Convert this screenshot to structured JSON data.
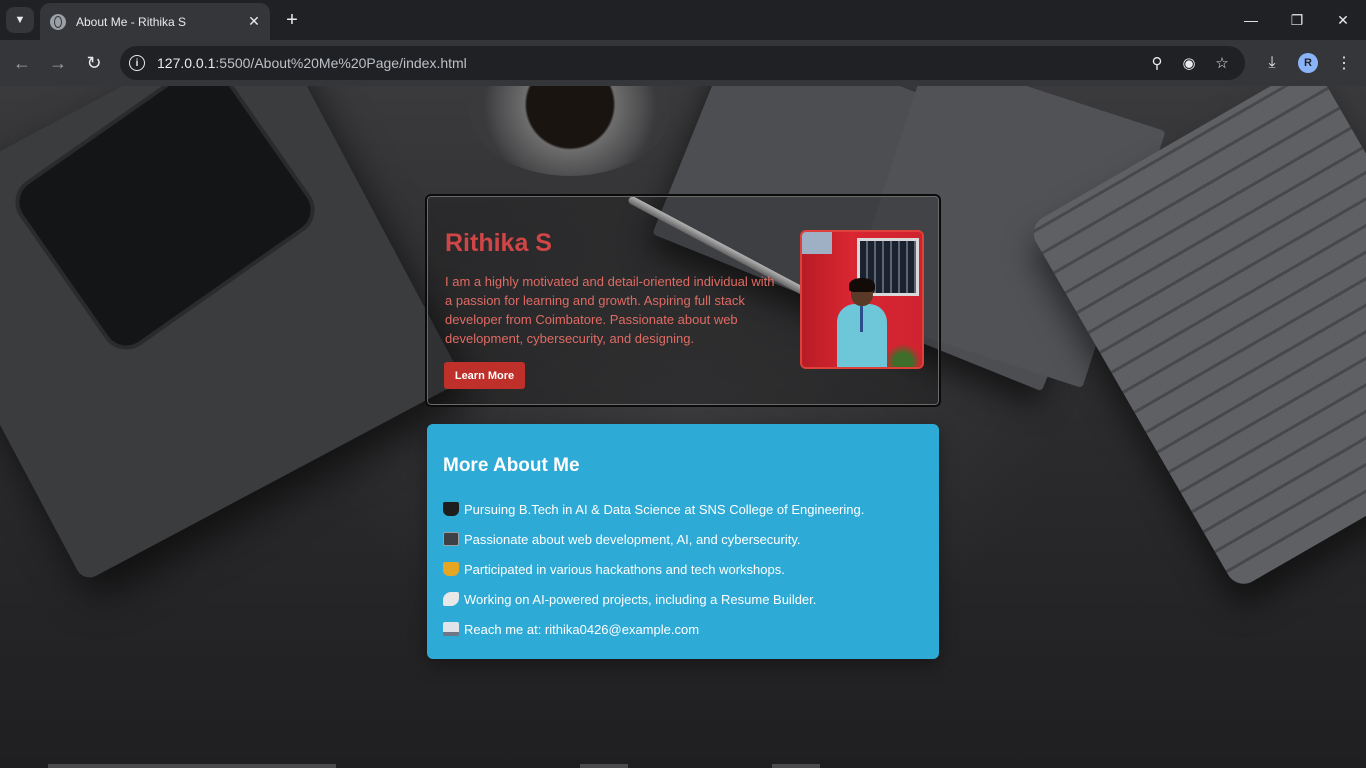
{
  "browser": {
    "tab_title": "About Me - Rithika S",
    "url_host": "127.0.0.1",
    "url_path": ":5500/About%20Me%20Page/index.html",
    "profile_initial": "R",
    "icons": {
      "tab_search": "chevron-down-icon",
      "favicon": "globe-icon",
      "tab_close": "close-icon",
      "new_tab": "plus-icon",
      "minimize": "minimize-icon",
      "restore": "restore-icon",
      "window_close": "close-icon",
      "back": "arrow-left-icon",
      "forward": "arrow-right-icon",
      "reload": "reload-icon",
      "site_info": "info-icon",
      "zoom": "zoom-out-icon",
      "tracking": "eye-off-icon",
      "bookmark": "star-icon",
      "download": "download-icon",
      "menu": "kebab-menu-icon"
    }
  },
  "profile": {
    "name": "Rithika S",
    "bio": "I am a highly motivated and detail-oriented individual with a passion for learning and growth. Aspiring full stack developer from Coimbatore. Passionate about web development, cybersecurity, and designing.",
    "button_label": "Learn More",
    "accent_color": "#d04545"
  },
  "more_about": {
    "title": "More About Me",
    "background_color": "#2eaad6",
    "items": [
      {
        "icon": "graduation-cap-icon",
        "text": "Pursuing B.Tech in AI & Data Science at SNS College of Engineering."
      },
      {
        "icon": "laptop-icon",
        "text": "Passionate about web development, AI, and cybersecurity."
      },
      {
        "icon": "trophy-icon",
        "text": "Participated in various hackathons and tech workshops."
      },
      {
        "icon": "rocket-icon",
        "text": "Working on AI-powered projects, including a Resume Builder."
      },
      {
        "icon": "inbox-icon",
        "text": "Reach me at: rithika0426@example.com"
      }
    ]
  }
}
